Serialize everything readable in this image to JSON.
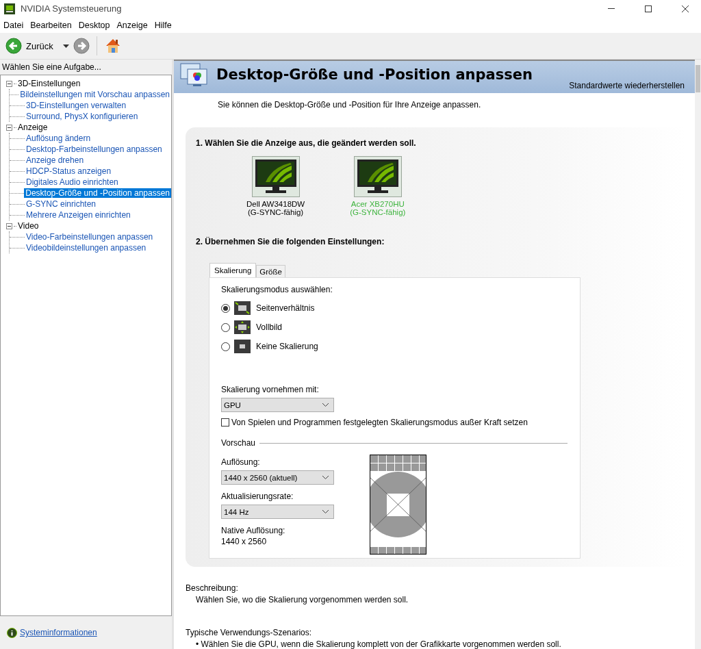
{
  "window": {
    "title": "NVIDIA Systemsteuerung"
  },
  "menu": [
    "Datei",
    "Bearbeiten",
    "Desktop",
    "Anzeige",
    "Hilfe"
  ],
  "toolbar": {
    "back_label": "Zurück"
  },
  "sidebar": {
    "heading": "Wählen Sie eine Aufgabe...",
    "tree": [
      {
        "label": "3D-Einstellungen",
        "expanded": true,
        "children": [
          {
            "label": "Bildeinstellungen mit Vorschau anpassen",
            "selected": false
          },
          {
            "label": "3D-Einstellungen verwalten",
            "selected": false
          },
          {
            "label": "Surround, PhysX konfigurieren",
            "selected": false
          }
        ]
      },
      {
        "label": "Anzeige",
        "expanded": true,
        "children": [
          {
            "label": "Auflösung ändern",
            "selected": false
          },
          {
            "label": "Desktop-Farbeinstellungen anpassen",
            "selected": false
          },
          {
            "label": "Anzeige drehen",
            "selected": false
          },
          {
            "label": "HDCP-Status anzeigen",
            "selected": false
          },
          {
            "label": "Digitales Audio einrichten",
            "selected": false
          },
          {
            "label": "Desktop-Größe und -Position anpassen",
            "selected": true
          },
          {
            "label": "G-SYNC einrichten",
            "selected": false
          },
          {
            "label": "Mehrere Anzeigen einrichten",
            "selected": false
          }
        ]
      },
      {
        "label": "Video",
        "expanded": true,
        "children": [
          {
            "label": "Video-Farbeinstellungen anpassen",
            "selected": false
          },
          {
            "label": "Videobildeinstellungen anpassen",
            "selected": false
          }
        ]
      }
    ],
    "footer_link": "Systeminformationen"
  },
  "page": {
    "title": "Desktop-Größe und -Position anpassen",
    "restore_link": "Standardwerte wiederherstellen",
    "intro": "Sie können die Desktop-Größe und -Position für Ihre Anzeige anpassen.",
    "step1": "1. Wählen Sie die Anzeige aus, die geändert werden soll.",
    "displays": [
      {
        "name": "Dell AW3418DW",
        "note": "(G-SYNC-fähig)",
        "selected": false
      },
      {
        "name": "Acer XB270HU",
        "note": "(G-SYNC-fähig)",
        "selected": true
      }
    ],
    "step2": "2. Übernehmen Sie die folgenden Einstellungen:",
    "tabs": [
      {
        "label": "Skalierung",
        "selected": true
      },
      {
        "label": "Größe",
        "selected": false
      }
    ],
    "mode_label": "Skalierungsmodus auswählen:",
    "modes": [
      {
        "kind": "aspect",
        "label": "Seitenverhältnis",
        "selected": true
      },
      {
        "kind": "fullscreen",
        "label": "Vollbild",
        "selected": false
      },
      {
        "kind": "none",
        "label": "Keine Skalierung",
        "selected": false
      }
    ],
    "perform_label": "Skalierung vornehmen mit:",
    "perform_value": "GPU",
    "override": {
      "label": "Von Spielen und Programmen festgelegten Skalierungsmodus außer Kraft setzen",
      "checked": false
    },
    "preview_heading": "Vorschau",
    "resolution_label": "Auflösung:",
    "resolution_value": "1440 x 2560 (aktuell)",
    "refresh_label": "Aktualisierungsrate:",
    "refresh_value": "144 Hz",
    "native_label": "Native Auflösung:",
    "native_value": "1440 x 2560",
    "description_label": "Beschreibung:",
    "description": "Wählen Sie, wo die Skalierung vorgenommen werden soll.",
    "scenarios_label": "Typische Verwendungs-Szenarios:",
    "scenarios": [
      "• Wählen Sie die GPU, wenn die Skalierung komplett von der Grafikkarte vorgenommen werden soll."
    ]
  }
}
